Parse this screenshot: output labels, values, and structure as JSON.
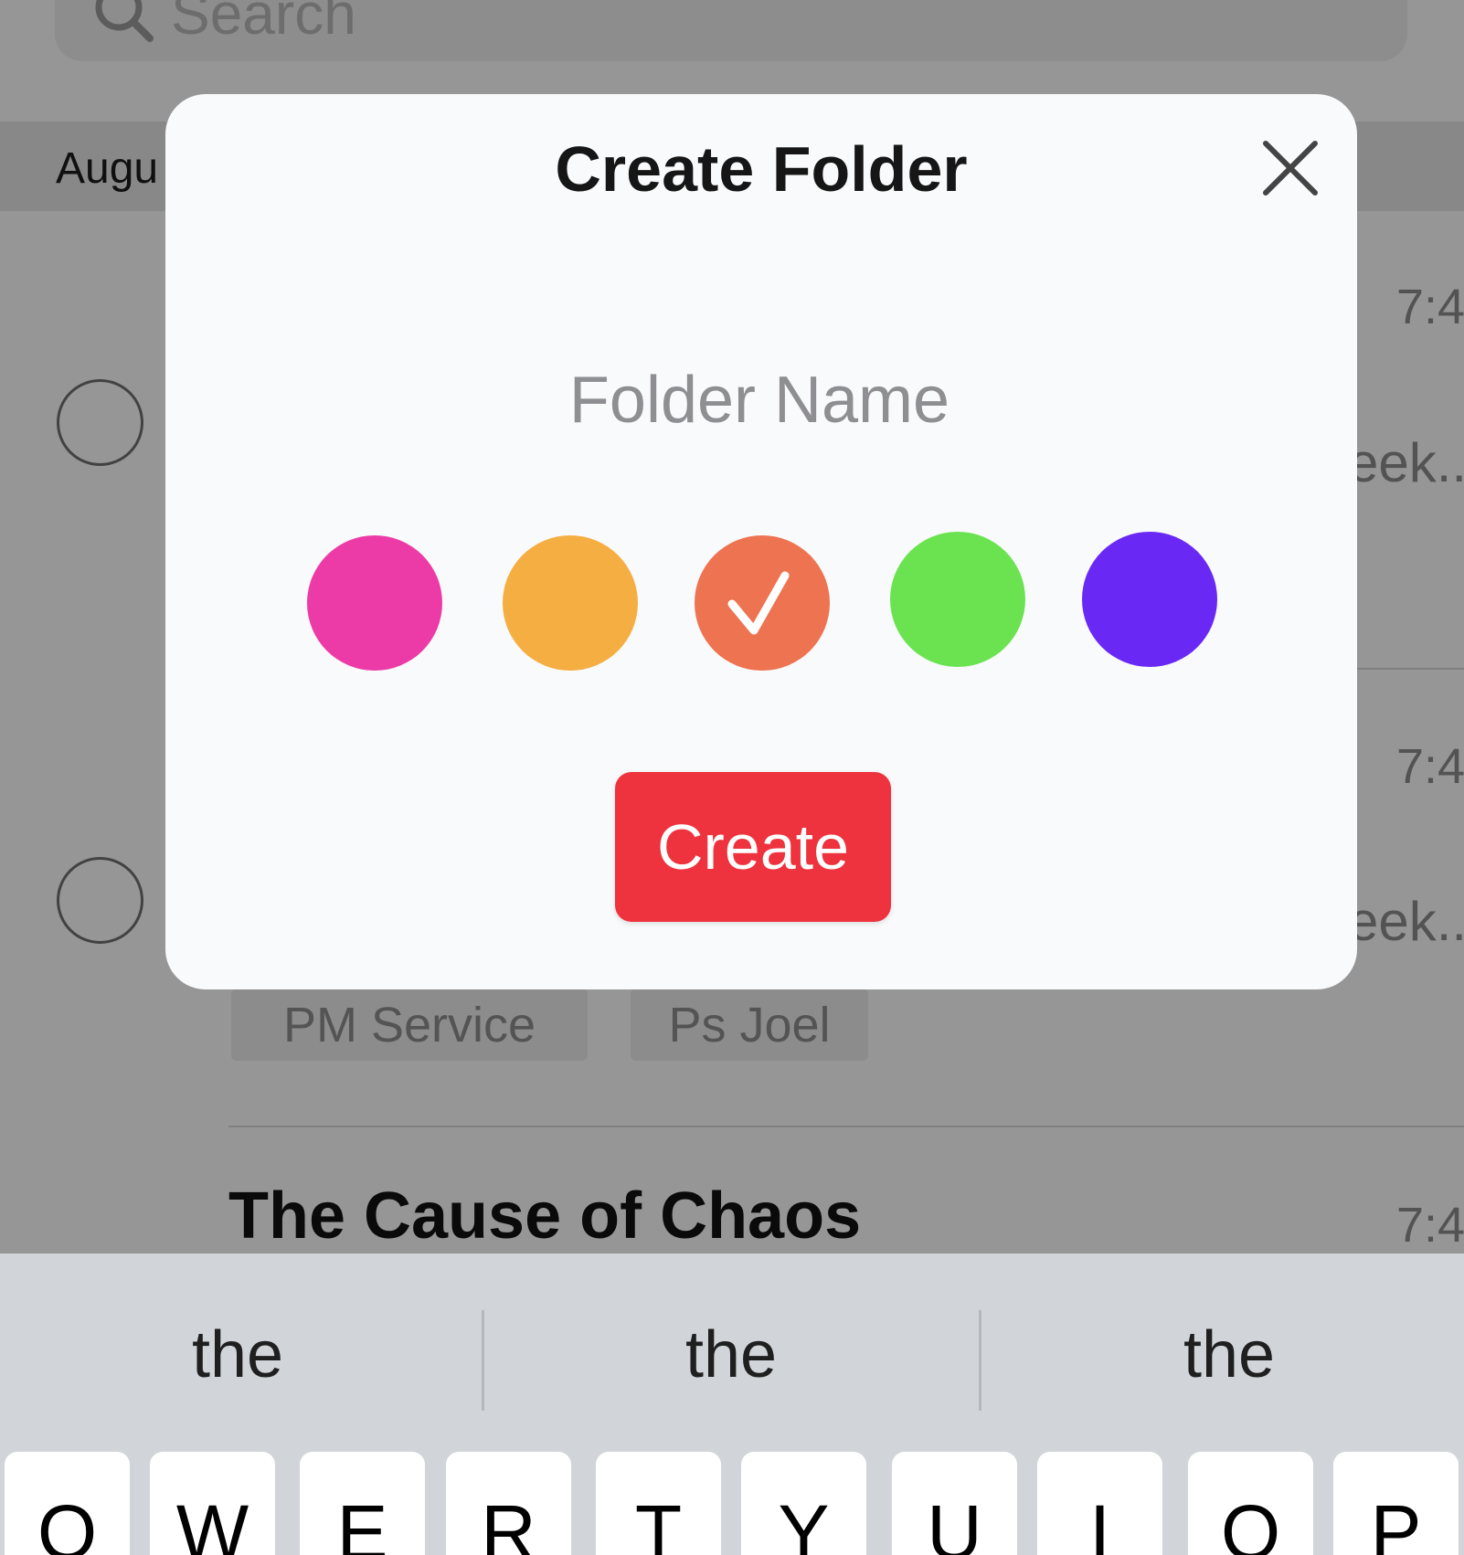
{
  "background": {
    "search_placeholder": "Search",
    "date_label": "Augu",
    "rows": [
      {
        "time": "7:4",
        "snippet": "eek.."
      },
      {
        "time": "7:4",
        "snippet": "eek.."
      },
      {
        "time": "7:4"
      }
    ],
    "tags": [
      "PM Service",
      "Ps Joel"
    ],
    "next_title": "The Cause of Chaos"
  },
  "modal": {
    "title": "Create Folder",
    "folder_name_placeholder": "Folder Name",
    "folder_name_value": "",
    "colors": [
      "#ec3ba6",
      "#f5ae42",
      "#ee7350",
      "#6be351",
      "#6a28f5"
    ],
    "selected_color": "#ee7350",
    "create_label": "Create"
  },
  "keyboard": {
    "suggestions": [
      "the",
      "the",
      "the"
    ],
    "keys": [
      "Q",
      "W",
      "E",
      "R",
      "T",
      "Y",
      "U",
      "I",
      "O",
      "P"
    ]
  },
  "icons": {
    "close": "close-icon",
    "search": "search-icon",
    "check": "check-icon"
  }
}
